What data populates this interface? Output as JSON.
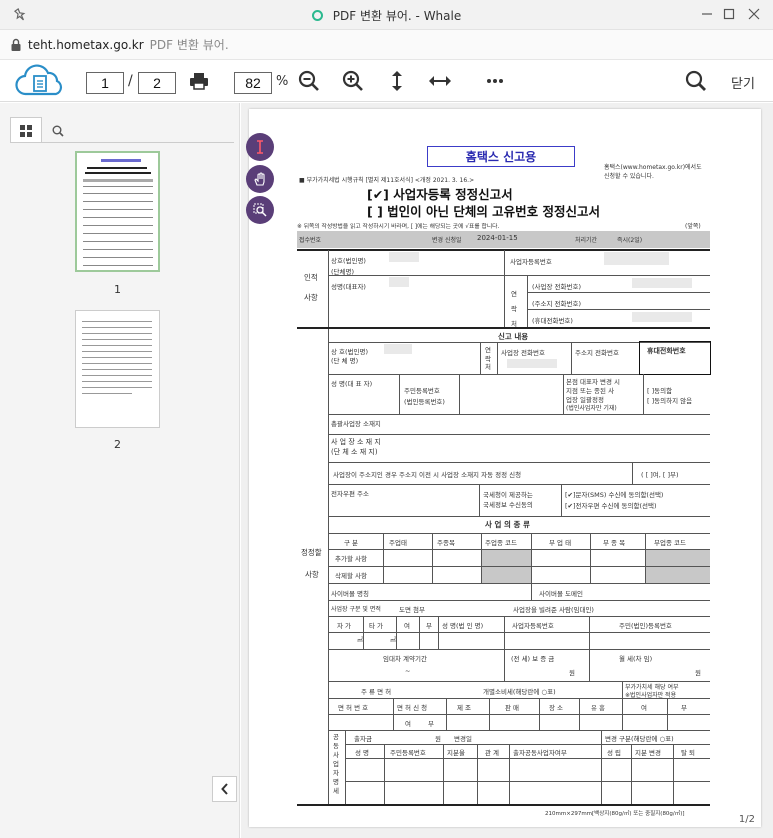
{
  "window": {
    "title": "PDF 변환 뷰어. - Whale"
  },
  "address": {
    "host": "teht.hometax.go.kr",
    "page_title": "PDF 변환 뷰어."
  },
  "toolbar": {
    "current_page": "1",
    "separator": "/",
    "total_pages": "2",
    "zoom": "82",
    "zoom_unit": "%",
    "close_label": "닫기"
  },
  "sidebar": {
    "thumbnails": [
      {
        "label": "1"
      },
      {
        "label": "2"
      }
    ]
  },
  "viewer": {
    "page_indicator": "1/2"
  },
  "doc": {
    "stamp": "홈택스 신고용",
    "site_note1": "홈택스(www.hometax.go.kr)에서도",
    "site_note2": "신청할 수 있습니다.",
    "regulation": "■ 부가가치세법 시행규칙 [별지 제11호서식] <개정 2021. 3. 16.>",
    "title1": "[✔] 사업자등록 정정신고서",
    "title2": "[  ] 법인이 아닌 단체의 고유번호 정정신고서",
    "instruction": "※ 뒤쪽의 작성방법을 읽고 작성하시기 바라며, [  ]에는 해당되는 곳에 √표를 합니다.",
    "side_front": "(앞쪽)",
    "receipt_no": "접수번호",
    "process_date_label": "변경 신청일",
    "process_date": "2024-01-15",
    "period_label": "처리기간",
    "period_value": "즉시(2일)",
    "identity_label1": "인적",
    "identity_label2": "사항",
    "trade_name": "상호(법인명)",
    "org_name": "(단체명)",
    "biz_reg_no": "사업자등록번호",
    "rep_name": "성명(대표자)",
    "contact_label": "연락처",
    "biz_phone": "(사업장 전화번호)",
    "home_phone": "(주소지 전화번호)",
    "mobile_phone": "(휴대전화번호)",
    "report_content": "신고 내용",
    "trade_name2": "상 호(법인명)",
    "org_name2": "(단 체 명)",
    "contact2": "연락처",
    "biz_phone2": "사업장 전화번호",
    "addr_phone2": "주소지 전화번호",
    "mobile_phone2": "휴대전화번호",
    "rep_label": "성 명(대 표 자)",
    "resident_no": "주민등록번호",
    "corp_no": "(법인등록번호)",
    "rep_change": "본점 대표자 변경 시",
    "rep_change2": "지점 또는 종된 사",
    "rep_change3": "업장 일괄정정",
    "rep_change4": "(법인사업자만 기재)",
    "agree": "[  ]동의함",
    "disagree": "[  ]동의하지 않음",
    "head_office": "총괄사업장 소재지",
    "biz_location": "사 업 장   소 재 지",
    "org_location": "(단 체 소 재 지)",
    "addr_change": "사업장이 주소지인 경우 주소지 이전 시 사업장 소재지 자동 정정 신청",
    "addr_change_opt": "( [  ]여, [  ]부)",
    "email": "전자우편 주소",
    "tax_info1": "국세청이 제공하는",
    "tax_info2": "국세정보 수신동의",
    "sms_agree": "[✔]문자(SMS) 수신에 동의함(선택)",
    "email_agree": "[✔]전자우편 수신에 동의함(선택)",
    "correction_label1": "정정할",
    "correction_label2": "사항",
    "biz_type": "사 업 의  종 류",
    "col_category": "구 분",
    "col_main_type": "주업태",
    "col_main_item": "주종목",
    "col_main_code": "주업종 코드",
    "col_sub_type": "부 업 태",
    "col_sub_item": "부 종 목",
    "col_sub_code": "부업종 코드",
    "row_add": "추가할 사항",
    "row_delete": "삭제할 사항",
    "cyber_name": "사이버몰 명칭",
    "cyber_domain": "사이버몰 도메인",
    "biz_class": "사업장 구분 및 면적",
    "land_area": "도면 첨부",
    "lessor": "사업장을 빌려준 사람(임대인)",
    "self": "자 가",
    "other": "타 가",
    "yes": "여",
    "no": "부",
    "lessor_name": "성 명(법 인 명)",
    "lessor_biz_no": "사업자등록번호",
    "lessor_res_no": "주민(법인)등록번호",
    "sqm1": "㎡",
    "sqm2": "㎡",
    "lease_period": "임대차 계약기간",
    "tilde": "~",
    "deposit": "(전 세) 보 증 금",
    "monthly": "월 세(차 임)",
    "won1": "원",
    "won2": "원",
    "license": "주 류 면 허",
    "excise": "개별소비세(해당란에 ○표)",
    "vat_note1": "부가가치세 해당 여부",
    "vat_note2": "※법인사업자만 적용",
    "license_no": "면 허 번 호",
    "license_apply": "면 허 신 청",
    "manufacture": "제 조",
    "sale": "판 매",
    "place": "장 소",
    "entertain": "유 흥",
    "yes2": "여",
    "no2": "부",
    "yes3": "여",
    "no3": "부",
    "joint_label": "공동사업자명세",
    "capital": "출자금",
    "won3": "원",
    "change_date": "변경일",
    "change_type": "변경 구분(해당란에 ○표)",
    "name_col": "성 명",
    "res_col": "주민등록번호",
    "share_col": "지분율",
    "relation_col": "관 계",
    "joint_rep": "출자공동사업자여부",
    "join_col": "성 립",
    "share_change": "지분 변경",
    "leave_col": "탈 퇴",
    "paper": "210mm×297mm[백상지(80g/㎡) 또는 중질지(80g/㎡)]"
  }
}
